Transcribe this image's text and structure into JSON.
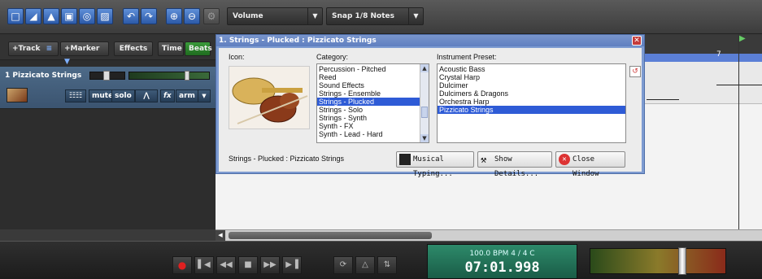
{
  "toolbar": {
    "volume_label": "Volume",
    "snap_label": "Snap 1/8 Notes",
    "icons": [
      "new-file-icon",
      "open-folder-icon",
      "open-recent-icon",
      "save-icon",
      "record-settings-icon",
      "export-icon",
      "undo-icon",
      "redo-icon",
      "zoom-in-icon",
      "zoom-out-icon",
      "settings-icon"
    ]
  },
  "leftpanel": {
    "add_track_label": "+Track",
    "add_marker_label": "+Marker",
    "effects_label": "Effects",
    "time_label": "Time",
    "beats_label": "Beats"
  },
  "track": {
    "name": "1 Pizzicato Strings",
    "mute_label": "mute",
    "solo_label": "solo",
    "fx_label": "fx",
    "arm_label": "arm"
  },
  "ruler": {
    "marker_number": "7"
  },
  "dialog": {
    "title": "1. Strings - Plucked : Pizzicato Strings",
    "icon_label": "Icon:",
    "category_label": "Category:",
    "preset_label": "Instrument Preset:",
    "categories": [
      {
        "label": "Percussion - Pitched",
        "selected": false
      },
      {
        "label": "Reed",
        "selected": false
      },
      {
        "label": "Sound Effects",
        "selected": false
      },
      {
        "label": "Strings - Ensemble",
        "selected": false
      },
      {
        "label": "Strings - Plucked",
        "selected": true
      },
      {
        "label": "Strings - Solo",
        "selected": false
      },
      {
        "label": "Strings - Synth",
        "selected": false
      },
      {
        "label": "Synth - FX",
        "selected": false
      },
      {
        "label": "Synth - Lead - Hard",
        "selected": false
      }
    ],
    "presets": [
      {
        "label": "Acoustic Bass",
        "selected": false
      },
      {
        "label": "Crystal Harp",
        "selected": false
      },
      {
        "label": "Dulcimer",
        "selected": false
      },
      {
        "label": "Dulcimers & Dragons",
        "selected": false
      },
      {
        "label": "Orchestra Harp",
        "selected": false
      },
      {
        "label": "Pizzicato Strings",
        "selected": true
      }
    ],
    "status_text": "Strings - Plucked : Pizzicato Strings",
    "musical_typing_label": "Musical Typing...",
    "show_details_label": "Show Details...",
    "close_window_label": "Close Window"
  },
  "transport": {
    "bpm_line": "100.0 BPM   4 / 4   C",
    "time_readout": "07:01.998"
  },
  "colors": {
    "accent_blue": "#2e5bd6",
    "dialog_frame": "#7d9bd1",
    "track_header": "#4d6a88",
    "display_green": "#1a5c47"
  }
}
